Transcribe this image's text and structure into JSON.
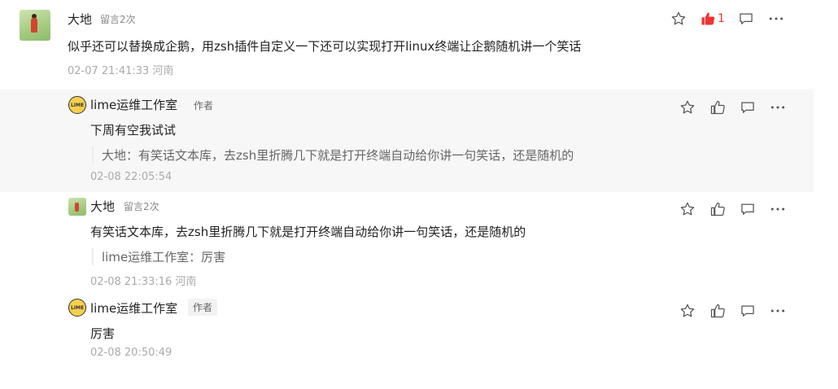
{
  "comments": [
    {
      "author": "大地",
      "meta": "留言2次",
      "text": "似乎还可以替换成企鹅，用zsh插件自定义一下还可以实现打开linux终端让企鹅随机讲一个笑话",
      "time": "02-07 21:41:33 河南",
      "likes": "1",
      "liked": true
    },
    {
      "author": "lime运维工作室",
      "tag": "作者",
      "text": "下周有空我试试",
      "quote": "大地：有笑话文本库，去zsh里折腾几下就是打开终端自动给你讲一句笑话，还是随机的",
      "time": "02-08 22:05:54"
    },
    {
      "author": "大地",
      "meta": "留言2次",
      "text": "有笑话文本库，去zsh里折腾几下就是打开终端自动给你讲一句笑话，还是随机的",
      "quote": "lime运维工作室：厉害",
      "time": "02-08 21:33:16 河南"
    },
    {
      "author": "lime运维工作室",
      "tag": "作者",
      "text": "厉害",
      "time": "02-08 20:50:49"
    }
  ],
  "avatar_lime_text": "LIME",
  "colors": {
    "like_active": "#e33",
    "icon": "#555",
    "highlight_bg": "#f7f7f7"
  }
}
